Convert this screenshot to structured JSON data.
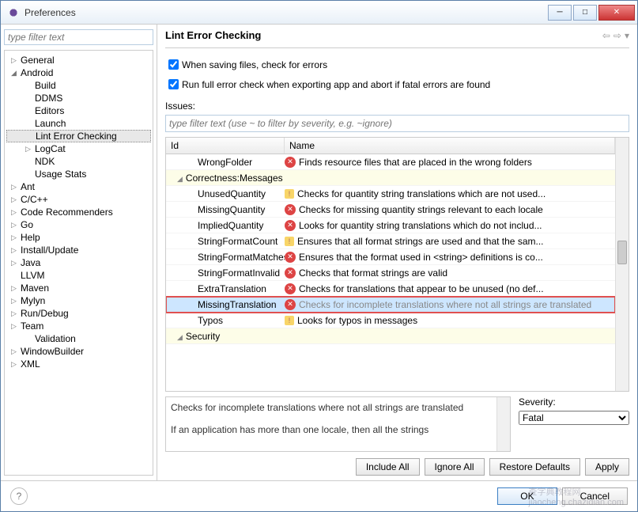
{
  "window": {
    "title": "Preferences"
  },
  "sidebar": {
    "filter_placeholder": "type filter text",
    "items": [
      {
        "label": "General",
        "level": 0,
        "expand": "▷"
      },
      {
        "label": "Android",
        "level": 0,
        "expand": "◢"
      },
      {
        "label": "Build",
        "level": 1,
        "expand": ""
      },
      {
        "label": "DDMS",
        "level": 1,
        "expand": ""
      },
      {
        "label": "Editors",
        "level": 1,
        "expand": ""
      },
      {
        "label": "Launch",
        "level": 1,
        "expand": ""
      },
      {
        "label": "Lint Error Checking",
        "level": 1,
        "expand": "",
        "selected": true
      },
      {
        "label": "LogCat",
        "level": 1,
        "expand": "▷"
      },
      {
        "label": "NDK",
        "level": 1,
        "expand": ""
      },
      {
        "label": "Usage Stats",
        "level": 1,
        "expand": ""
      },
      {
        "label": "Ant",
        "level": 0,
        "expand": "▷"
      },
      {
        "label": "C/C++",
        "level": 0,
        "expand": "▷"
      },
      {
        "label": "Code Recommenders",
        "level": 0,
        "expand": "▷"
      },
      {
        "label": "Go",
        "level": 0,
        "expand": "▷"
      },
      {
        "label": "Help",
        "level": 0,
        "expand": "▷"
      },
      {
        "label": "Install/Update",
        "level": 0,
        "expand": "▷"
      },
      {
        "label": "Java",
        "level": 0,
        "expand": "▷"
      },
      {
        "label": "LLVM",
        "level": 0,
        "expand": ""
      },
      {
        "label": "Maven",
        "level": 0,
        "expand": "▷"
      },
      {
        "label": "Mylyn",
        "level": 0,
        "expand": "▷"
      },
      {
        "label": "Run/Debug",
        "level": 0,
        "expand": "▷"
      },
      {
        "label": "Team",
        "level": 0,
        "expand": "▷"
      },
      {
        "label": "Validation",
        "level": 1,
        "expand": ""
      },
      {
        "label": "WindowBuilder",
        "level": 0,
        "expand": "▷"
      },
      {
        "label": "XML",
        "level": 0,
        "expand": "▷"
      }
    ]
  },
  "main": {
    "title": "Lint Error Checking",
    "check1": "When saving files, check for errors",
    "check2": "Run full error check when exporting app and abort if fatal errors are found",
    "issues_label": "Issues:",
    "issues_filter_placeholder": "type filter text (use ~ to filter by severity, e.g. ~ignore)",
    "col_id": "Id",
    "col_name": "Name",
    "rows": [
      {
        "id": "WrongFolder",
        "name": "Finds resource files that are placed in the wrong folders",
        "sev": "err"
      },
      {
        "id": "Correctness:Messages",
        "group": true
      },
      {
        "id": "UnusedQuantity",
        "name": "Checks for quantity string translations which are not used...",
        "sev": "warn"
      },
      {
        "id": "MissingQuantity",
        "name": "Checks for missing quantity strings relevant to each locale",
        "sev": "err"
      },
      {
        "id": "ImpliedQuantity",
        "name": "Looks for quantity string translations which do not includ...",
        "sev": "err"
      },
      {
        "id": "StringFormatCount",
        "name": "Ensures that all format strings are used and that the sam...",
        "sev": "warn"
      },
      {
        "id": "StringFormatMatches",
        "name": "Ensures that the format used in <string> definitions is co...",
        "sev": "err"
      },
      {
        "id": "StringFormatInvalid",
        "name": "Checks that format strings are valid",
        "sev": "err"
      },
      {
        "id": "ExtraTranslation",
        "name": "Checks for translations that appear to be unused (no def...",
        "sev": "err"
      },
      {
        "id": "MissingTranslation",
        "name": "Checks for incomplete translations where not all strings are translated",
        "sev": "err",
        "selected": true,
        "highlight": true
      },
      {
        "id": "Typos",
        "name": "Looks for typos in messages",
        "sev": "warn"
      },
      {
        "id": "Security",
        "group": true
      }
    ],
    "detail": "Checks for incomplete translations where not all strings are translated\n\nIf an application has more than one locale, then all the strings",
    "severity_label": "Severity:",
    "severity_value": "Fatal",
    "btn_include": "Include All",
    "btn_ignore": "Ignore All",
    "btn_restore": "Restore Defaults",
    "btn_apply": "Apply"
  },
  "footer": {
    "ok": "OK",
    "cancel": "Cancel"
  },
  "watermark": "查字典教程网\njiaocheng.chazidian.com"
}
